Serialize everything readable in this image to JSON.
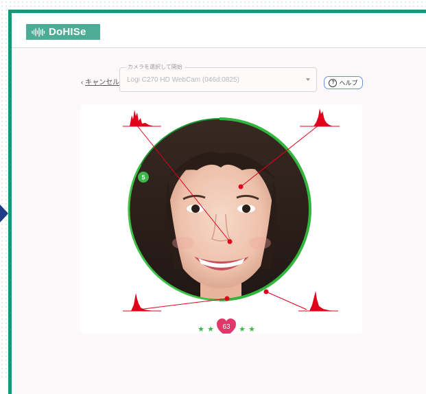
{
  "app": {
    "logo_text": "DoHISe",
    "logo_icon": "waveform-icon"
  },
  "toolbar": {
    "cancel_label": "キャンセル",
    "camera_legend": "カメラを選択して開始",
    "camera_value": "Logi C270 HD WebCam (046d:0825)",
    "help_label": "ヘルプ"
  },
  "face_panel": {
    "progress_badge": "5",
    "score": "63",
    "stars": 4,
    "colors": {
      "accent": "#3cb84a",
      "marker": "#e0001b",
      "brand": "#18977a"
    }
  }
}
